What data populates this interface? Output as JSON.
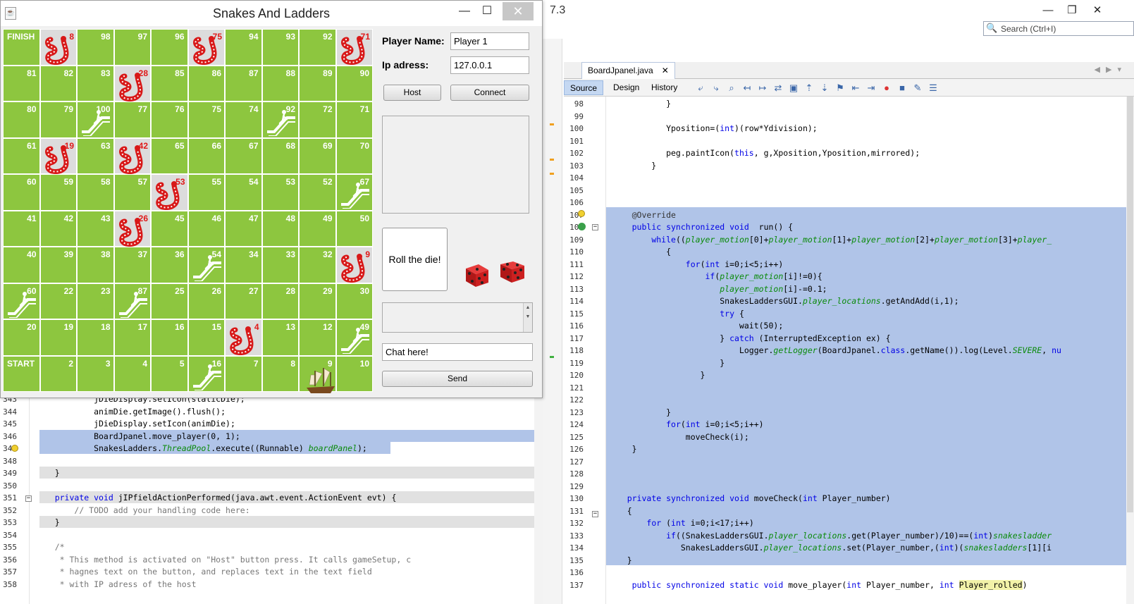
{
  "game": {
    "title": "Snakes And Ladders",
    "board_rows": [
      [
        {
          "t": "FINISH",
          "pos": "l"
        },
        {
          "snake": "8",
          "g": true
        },
        {
          "t": "98"
        },
        {
          "t": "97"
        },
        {
          "t": "96"
        },
        {
          "snake": "75",
          "g": true
        },
        {
          "t": "94"
        },
        {
          "t": "93"
        },
        {
          "t": "92"
        },
        {
          "snake": "71",
          "g": true
        }
      ],
      [
        {
          "t": "81"
        },
        {
          "t": "82"
        },
        {
          "t": "83"
        },
        {
          "snake": "28",
          "g": true
        },
        {
          "t": "85"
        },
        {
          "t": "86"
        },
        {
          "t": "87"
        },
        {
          "t": "88"
        },
        {
          "t": "89"
        },
        {
          "t": "90"
        }
      ],
      [
        {
          "t": "80"
        },
        {
          "t": "79"
        },
        {
          "ladder": "100"
        },
        {
          "t": "77"
        },
        {
          "t": "76"
        },
        {
          "t": "75"
        },
        {
          "t": "74"
        },
        {
          "ladder": "92"
        },
        {
          "t": "72"
        },
        {
          "t": "71"
        }
      ],
      [
        {
          "t": "61"
        },
        {
          "snake": "19",
          "g": true
        },
        {
          "t": "63"
        },
        {
          "snake": "42",
          "g": true
        },
        {
          "t": "65"
        },
        {
          "t": "66"
        },
        {
          "t": "67"
        },
        {
          "t": "68"
        },
        {
          "t": "69"
        },
        {
          "t": "70"
        }
      ],
      [
        {
          "t": "60"
        },
        {
          "t": "59"
        },
        {
          "t": "58"
        },
        {
          "t": "57"
        },
        {
          "snake": "53",
          "g": true
        },
        {
          "t": "55"
        },
        {
          "t": "54"
        },
        {
          "t": "53"
        },
        {
          "t": "52"
        },
        {
          "ladder": "67"
        }
      ],
      [
        {
          "t": "41"
        },
        {
          "t": "42"
        },
        {
          "t": "43"
        },
        {
          "snake": "26",
          "g": true
        },
        {
          "t": "45"
        },
        {
          "t": "46"
        },
        {
          "t": "47"
        },
        {
          "t": "48"
        },
        {
          "t": "49"
        },
        {
          "t": "50"
        }
      ],
      [
        {
          "t": "40"
        },
        {
          "t": "39"
        },
        {
          "t": "38"
        },
        {
          "t": "37"
        },
        {
          "t": "36"
        },
        {
          "ladder": "54"
        },
        {
          "t": "34"
        },
        {
          "t": "33"
        },
        {
          "t": "32"
        },
        {
          "snake": "9",
          "g": true
        }
      ],
      [
        {
          "ladder": "60"
        },
        {
          "t": "22"
        },
        {
          "t": "23"
        },
        {
          "ladder": "87"
        },
        {
          "t": "25"
        },
        {
          "t": "26"
        },
        {
          "t": "27"
        },
        {
          "t": "28"
        },
        {
          "t": "29"
        },
        {
          "t": "30"
        }
      ],
      [
        {
          "t": "20"
        },
        {
          "t": "19"
        },
        {
          "t": "18"
        },
        {
          "t": "17"
        },
        {
          "t": "16"
        },
        {
          "t": "15"
        },
        {
          "snake": "4",
          "g": true
        },
        {
          "t": "13"
        },
        {
          "t": "12"
        },
        {
          "ladder": "49"
        }
      ],
      [
        {
          "t": "START",
          "pos": "l"
        },
        {
          "t": "2"
        },
        {
          "t": "3"
        },
        {
          "t": "4"
        },
        {
          "t": "5"
        },
        {
          "ladder": "16"
        },
        {
          "t": "7"
        },
        {
          "t": "8"
        },
        {
          "ship": "9"
        },
        {
          "t": "10"
        }
      ]
    ],
    "player_name_label": "Player Name:",
    "player_name_value": "Player 1",
    "ip_label": "Ip adress:",
    "ip_value": "127.0.0.1",
    "host_button": "Host",
    "connect_button": "Connect",
    "roll_button": "Roll the die!",
    "chat_value": "Chat here!",
    "send_button": "Send"
  },
  "ide": {
    "version_fragment": "7.3",
    "search_placeholder": "Search (Ctrl+I)",
    "file_tab": "BoardJpanel.java",
    "subtabs": [
      "Source",
      "Design",
      "History"
    ],
    "right_code": [
      {
        "n": "98",
        "h": "            }"
      },
      {
        "n": "99",
        "h": ""
      },
      {
        "n": "100",
        "h": "            Yposition=(<span class=\"kw\">int</span>)(row*Ydivision);"
      },
      {
        "n": "101",
        "h": ""
      },
      {
        "n": "102",
        "h": "            peg.paintIcon(<span class=\"kw\">this</span>, g,Xposition,Yposition,mirrored);"
      },
      {
        "n": "103",
        "h": "         }"
      },
      {
        "n": "104",
        "h": ""
      },
      {
        "n": "105",
        "h": ""
      },
      {
        "n": "106",
        "h": ""
      },
      {
        "n": "107",
        "h": "     <span class=\"ann\">@Override</span>"
      },
      {
        "n": "108",
        "h": "     <span class=\"kw\">public synchronized void</span>  run() {"
      },
      {
        "n": "109",
        "h": "         <span class=\"kw\">while</span>((<span class=\"it\">player_motion</span>[0]+<span class=\"it\">player_motion</span>[1]+<span class=\"it\">player_motion</span>[2]+<span class=\"it\">player_motion</span>[3]+<span class=\"it\">player_</span>"
      },
      {
        "n": "110",
        "h": "            {"
      },
      {
        "n": "111",
        "h": "                <span class=\"kw\">for</span>(<span class=\"kw\">int</span> i=0;i&lt;5;i++)"
      },
      {
        "n": "112",
        "h": "                    <span class=\"kw\">if</span>(<span class=\"it\">player_motion</span>[i]!=0){"
      },
      {
        "n": "113",
        "h": "                       <span class=\"it\">player_motion</span>[i]-=0.1;"
      },
      {
        "n": "114",
        "h": "                       SnakesLaddersGUI.<span class=\"it\">player_locations</span>.getAndAdd(i,1);"
      },
      {
        "n": "115",
        "h": "                       <span class=\"kw\">try</span> {"
      },
      {
        "n": "116",
        "h": "                           wait(50);"
      },
      {
        "n": "117",
        "h": "                       } <span class=\"kw\">catch</span> (InterruptedException ex) {"
      },
      {
        "n": "118",
        "h": "                           Logger.<span class=\"it\">getLogger</span>(BoardJpanel.<span class=\"kw\">class</span>.getName()).log(Level.<span class=\"it\">SEVERE</span>, <span class=\"kw\">nu</span>"
      },
      {
        "n": "119",
        "h": "                       }"
      },
      {
        "n": "120",
        "h": "                   }"
      },
      {
        "n": "121",
        "h": ""
      },
      {
        "n": "122",
        "h": ""
      },
      {
        "n": "123",
        "h": "            }"
      },
      {
        "n": "124",
        "h": "            <span class=\"kw\">for</span>(<span class=\"kw\">int</span> i=0;i&lt;5;i++)"
      },
      {
        "n": "125",
        "h": "                moveCheck(i);"
      },
      {
        "n": "126",
        "h": "     }"
      },
      {
        "n": "127",
        "h": ""
      },
      {
        "n": "128",
        "h": ""
      },
      {
        "n": "129",
        "h": ""
      },
      {
        "n": "130",
        "h": "    <span class=\"kw\">private synchronized void</span> moveCheck(<span class=\"kw\">int</span> Player_number)"
      },
      {
        "n": "131",
        "h": "    {"
      },
      {
        "n": "132",
        "h": "        <span class=\"kw\">for</span> (<span class=\"kw\">int</span> i=0;i&lt;17;i++)"
      },
      {
        "n": "133",
        "h": "            <span class=\"kw\">if</span>((SnakesLaddersGUI.<span class=\"it\">player_locations</span>.get(Player_number)/10)==(<span class=\"kw\">int</span>)<span class=\"it\">snakesladder</span>"
      },
      {
        "n": "134",
        "h": "               SnakesLaddersGUI.<span class=\"it\">player_locations</span>.set(Player_number,(<span class=\"kw\">int</span>)(<span class=\"it\">snakesladders</span>[1][i"
      },
      {
        "n": "135",
        "h": "    }"
      },
      {
        "n": "136",
        "h": ""
      },
      {
        "n": "137",
        "h": "     <span class=\"kw\">public synchronized static void</span> move_player(<span class=\"kw\">int</span> Player_number, <span class=\"kw\">int</span> <span class=\"hl-yellow\">Player_rolled</span>)"
      }
    ],
    "left_code": [
      {
        "n": "343",
        "h": "            jDieDisplay.setIcon(staticDie);"
      },
      {
        "n": "344",
        "h": "            animDie.getImage().flush();"
      },
      {
        "n": "345",
        "h": "            jDieDisplay.setIcon(animDie);"
      },
      {
        "n": "346",
        "h": "            BoardJpanel.move_player(0, 1);"
      },
      {
        "n": "347",
        "h": "            SnakesLadders.<span class=\"it\">ThreadPool</span>.execute((Runnable) <span class=\"it\">boardPanel</span>);"
      },
      {
        "n": "348",
        "h": ""
      },
      {
        "n": "349",
        "h": "    }"
      },
      {
        "n": "350",
        "h": ""
      },
      {
        "n": "351",
        "h": "    <span class=\"kw\">private void</span> jIPfieldActionPerformed(java.awt.event.ActionEvent evt) {"
      },
      {
        "n": "352",
        "h": "        <span class=\"cm\">// TODO add your handling code here:</span>"
      },
      {
        "n": "353",
        "h": "    }"
      },
      {
        "n": "354",
        "h": ""
      },
      {
        "n": "355",
        "h": "    <span class=\"cm\">/*</span>"
      },
      {
        "n": "356",
        "h": "    <span class=\"cm\"> * This method is activated on \"Host\" button press. It calls gameSetup, c</span>"
      },
      {
        "n": "357",
        "h": "    <span class=\"cm\"> * hagnes text on the button, and replaces text in the text field</span>"
      },
      {
        "n": "358",
        "h": "    <span class=\"cm\"> * with IP adress of the host</span>"
      }
    ]
  }
}
